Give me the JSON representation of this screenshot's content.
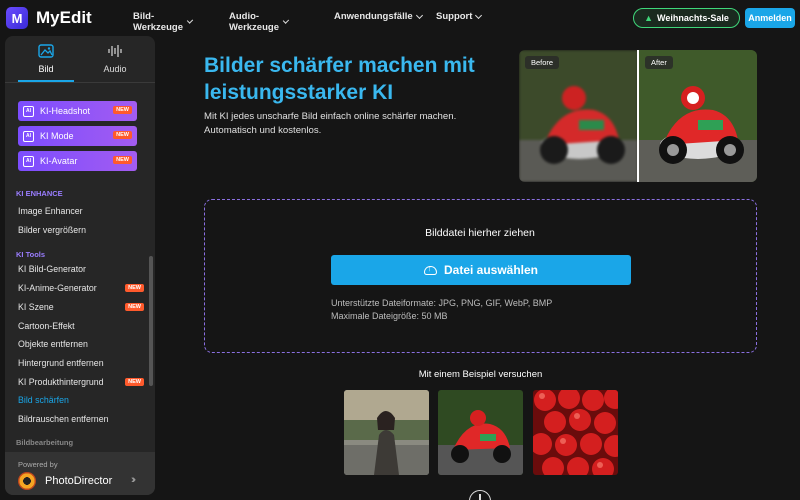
{
  "brand": {
    "logo_letter": "M",
    "name": "MyEdit"
  },
  "nav": {
    "items": [
      {
        "label": "Bild-Werkzeuge"
      },
      {
        "label": "Audio-Werkzeuge"
      },
      {
        "label": "Anwendungsfälle"
      },
      {
        "label": "Support"
      }
    ],
    "sale_label": "Weihnachts-Sale",
    "login_label": "Anmelden"
  },
  "sidebar": {
    "tabs": [
      {
        "label": "Bild",
        "active": true
      },
      {
        "label": "Audio",
        "active": false
      }
    ],
    "feature_buttons": [
      {
        "label": "KI-Headshot",
        "badge": "NEW"
      },
      {
        "label": "KI Mode",
        "badge": "NEW"
      },
      {
        "label": "KI-Avatar",
        "badge": "NEW"
      }
    ],
    "section_enhance": "KI ENHANCE",
    "enhance_items": [
      {
        "label": "Image Enhancer"
      },
      {
        "label": "Bilder vergrößern"
      }
    ],
    "section_tools": "KI Tools",
    "tool_items": [
      {
        "label": "KI Bild-Generator",
        "badge": ""
      },
      {
        "label": "KI-Anime-Generator",
        "badge": "NEW"
      },
      {
        "label": "KI Szene",
        "badge": "NEW"
      },
      {
        "label": "Cartoon-Effekt",
        "badge": ""
      },
      {
        "label": "Objekte entfernen",
        "badge": ""
      },
      {
        "label": "Hintergrund entfernen",
        "badge": ""
      },
      {
        "label": "KI Produkthintergrund",
        "badge": "NEW"
      },
      {
        "label": "Bild schärfen",
        "badge": "",
        "active": true
      },
      {
        "label": "Bildrauschen entfernen",
        "badge": ""
      }
    ],
    "section_edit": "Bildbearbeitung",
    "powered_by": "Powered by",
    "powered_product": "PhotoDirector"
  },
  "hero": {
    "title": "Bilder schärfer machen mit leistungsstarker KI",
    "description": "Mit KI jedes unscharfe Bild einfach online schärfer machen. Automatisch und kostenlos.",
    "before_label": "Before",
    "after_label": "After"
  },
  "dropzone": {
    "title": "Bilddatei hierher ziehen",
    "button_label": "Datei auswählen",
    "formats": "Unterstützte Dateiformate: JPG, PNG, GIF, WebP, BMP",
    "max_size": "Maximale Dateigröße: 50 MB"
  },
  "examples": {
    "label": "Mit einem Beispiel versuchen"
  },
  "colors": {
    "accent": "#1aa6e8",
    "title_blue": "#3ab8ef",
    "purple": "#7c4dff",
    "new_badge": "#ff5a2c",
    "sale_border": "#3fd77a"
  }
}
